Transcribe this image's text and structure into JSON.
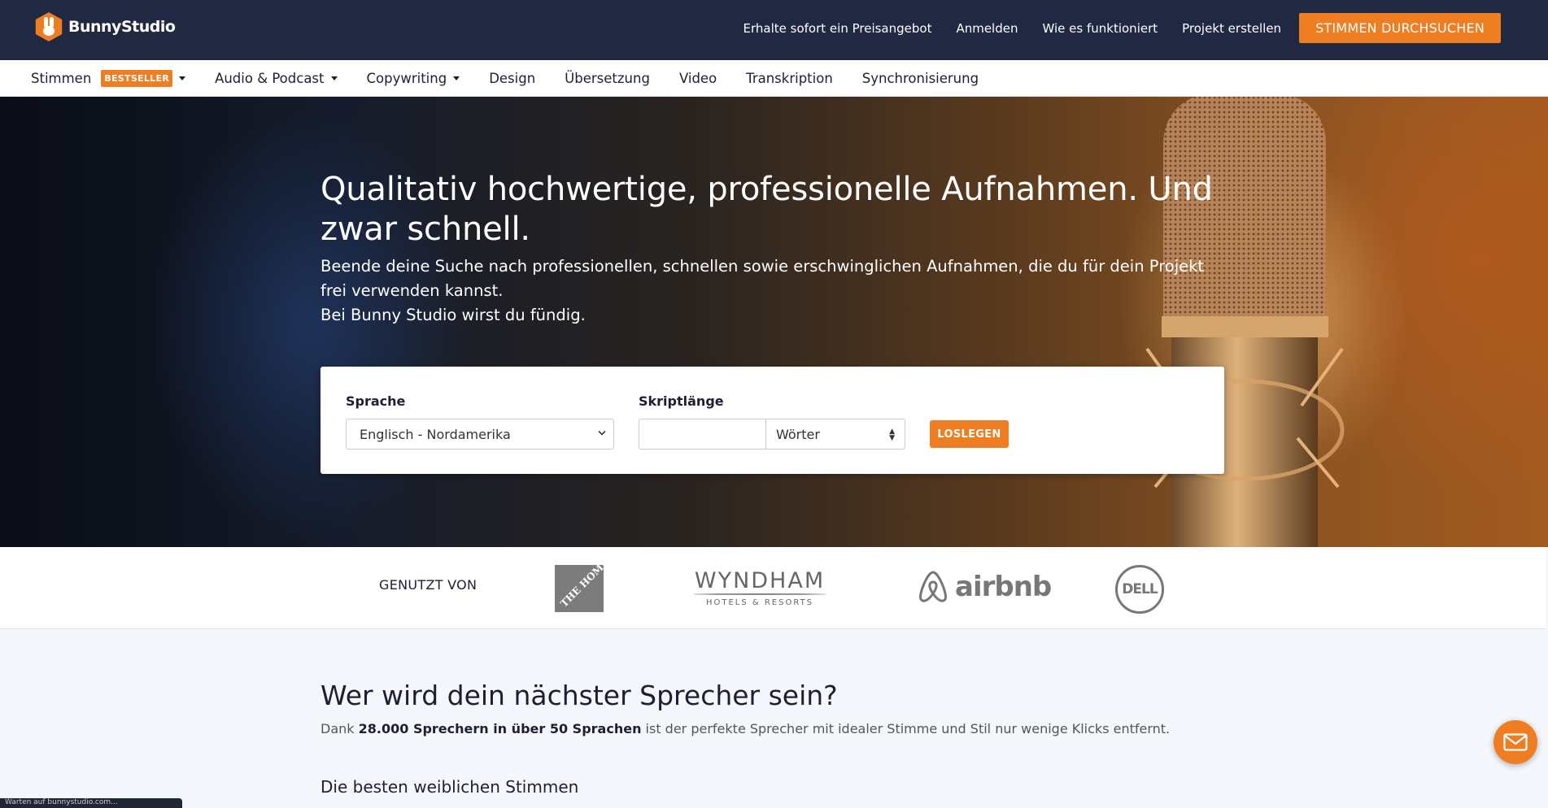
{
  "brand": {
    "name": "BunnyStudio",
    "accent": "#ef7d22",
    "navy": "#202842"
  },
  "topnav": {
    "links": [
      "Erhalte sofort ein Preisangebot",
      "Anmelden",
      "Wie es funktioniert",
      "Projekt erstellen"
    ],
    "cta": "STIMMEN DURCHSUCHEN"
  },
  "subnav": {
    "items": [
      {
        "label": "Stimmen",
        "badge": "BESTSELLER",
        "dropdown": true
      },
      {
        "label": "Audio & Podcast",
        "dropdown": true
      },
      {
        "label": "Copywriting",
        "dropdown": true
      },
      {
        "label": "Design"
      },
      {
        "label": "Übersetzung"
      },
      {
        "label": "Video"
      },
      {
        "label": "Transkription"
      },
      {
        "label": "Synchronisierung"
      }
    ]
  },
  "hero": {
    "title": "Qualitativ hochwertige, professionelle Aufnahmen. Und zwar schnell.",
    "subtitle": "Beende deine Suche nach professionellen, schnellen sowie erschwinglichen Aufnahmen, die du für dein Projekt frei verwenden kannst.",
    "subtitle2": "Bei Bunny Studio wirst du fündig."
  },
  "search": {
    "language_label": "Sprache",
    "language_value": "Englisch - Nordamerika",
    "length_label": "Skriptlänge",
    "length_value": "",
    "unit_value": "Wörter",
    "submit": "LOSLEGEN"
  },
  "clients": {
    "label": "GENUTZT VON",
    "logos": [
      "the-home-depot-logo",
      "wyndham-logo",
      "airbnb-logo",
      "dell-logo"
    ],
    "wyndham_main": "WYNDHAM",
    "wyndham_sub": "HOTELS & RESORTS",
    "airbnb": "airbnb",
    "dell": "DELL",
    "homedepot": "THE HOME DEPOT"
  },
  "section": {
    "title": "Wer wird dein nächster Sprecher sein?",
    "lead_prefix": "Dank ",
    "lead_bold": "28.000 Sprechern in über 50 Sprachen",
    "lead_suffix": " ist der perfekte Sprecher mit idealer Stimme und Stil nur wenige Klicks entfernt.",
    "subtitle": "Die besten weiblichen Stimmen"
  },
  "statusbar": {
    "text": "Warten auf bunnystudio.com..."
  }
}
